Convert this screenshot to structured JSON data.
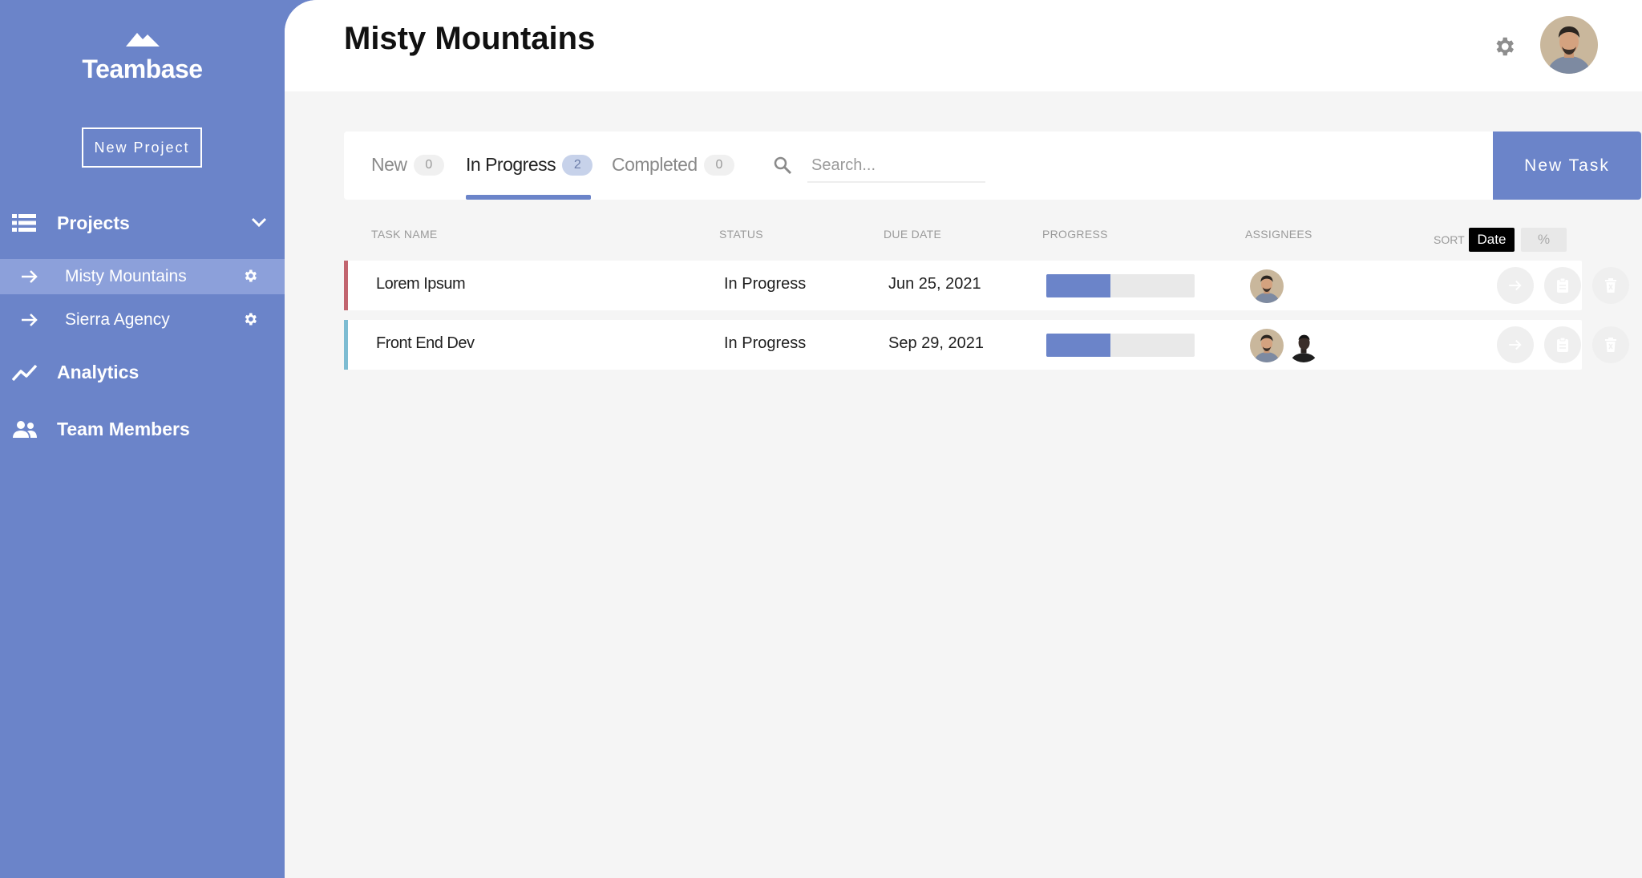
{
  "app": {
    "name": "Teambase"
  },
  "sidebar": {
    "new_project_label": "New Project",
    "projects_label": "Projects",
    "projects": [
      {
        "label": "Misty Mountains",
        "active": true
      },
      {
        "label": "Sierra Agency",
        "active": false
      }
    ],
    "analytics_label": "Analytics",
    "team_members_label": "Team Members"
  },
  "header": {
    "title": "Misty Mountains"
  },
  "tabs": [
    {
      "label": "New",
      "count": "0",
      "active": false
    },
    {
      "label": "In Progress",
      "count": "2",
      "active": true
    },
    {
      "label": "Completed",
      "count": "0",
      "active": false
    }
  ],
  "search": {
    "placeholder": "Search...",
    "value": ""
  },
  "new_task_label": "New Task",
  "table": {
    "columns": [
      "TASK NAME",
      "STATUS",
      "DUE DATE",
      "PROGRESS",
      "ASSIGNEES"
    ],
    "sort_label": "SORT",
    "sort_options": [
      "Date",
      "%"
    ],
    "sort_selected": "Date",
    "rows": [
      {
        "name": "Lorem Ipsum",
        "status": "In Progress",
        "due": "Jun 25, 2021",
        "progress": 0.43,
        "assignees": 1,
        "stripe_color": "#c2656f"
      },
      {
        "name": "Front End Dev",
        "status": "In Progress",
        "due": "Sep 29, 2021",
        "progress": 0.43,
        "assignees": 2,
        "stripe_color": "#7dbcd2"
      }
    ]
  },
  "colors": {
    "primary": "#6b84c9",
    "active_item": "#8ca0da",
    "background": "#f5f5f5"
  },
  "icons": [
    "mountain-logo-icon",
    "list-icon",
    "chevron-down-icon",
    "arrow-right-icon",
    "gear-icon",
    "chart-line-icon",
    "users-icon",
    "search-icon",
    "avatar",
    "clipboard-icon",
    "trash-icon"
  ]
}
